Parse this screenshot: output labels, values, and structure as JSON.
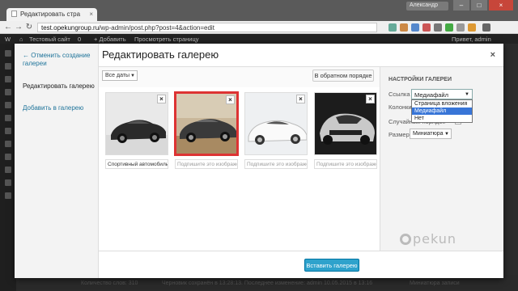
{
  "browser": {
    "tab_title": "Редактировать стра",
    "user_badge": "Александр",
    "url_host": "test.opekungroup.ru",
    "url_path": "/wp-admin/post.php?post=4&action=edit"
  },
  "adminbar": {
    "site_name": "Тестовый сайт",
    "comments_count": "0",
    "add_new": "+ Добавить",
    "view_page": "Просмотреть страницу",
    "greeting": "Привет, admin"
  },
  "wp_footer": {
    "word_count": "Количество слов: 310",
    "saved": "Черновик сохранён в 13:28:13. Последнее изменение: admin 10.05.2015 в 13:16",
    "thumbnail": "Миниатюра записи"
  },
  "modal": {
    "cancel_link": "← Отменить создание галереи",
    "side_current": "Редактировать галерею",
    "side_add": "Добавить в галерею",
    "title": "Редактировать галерею",
    "close": "×",
    "date_filter": "Все даты",
    "reverse_button": "В обратном порядке",
    "thumbnails": [
      {
        "caption": "Спортивный автомобиль",
        "selected": false
      },
      {
        "caption": "Подпишите это изображение",
        "selected": true
      },
      {
        "caption": "Подпишите это изображение",
        "selected": false
      },
      {
        "caption": "Подпишите это изображение",
        "selected": false
      }
    ],
    "settings": {
      "title": "НАСТРОЙКИ ГАЛЕРЕИ",
      "link_label": "Ссылка",
      "link_value": "Медиафайл",
      "link_options": [
        "Страница вложения",
        "Медиафайл",
        "Нет"
      ],
      "link_highlighted": "Медиафайл",
      "columns_label": "Колонки",
      "random_label": "Случайный порядок",
      "size_label": "Размер",
      "size_value": "Миниатюра"
    },
    "insert_button": "Вставить галерею"
  },
  "watermark": "pekun"
}
